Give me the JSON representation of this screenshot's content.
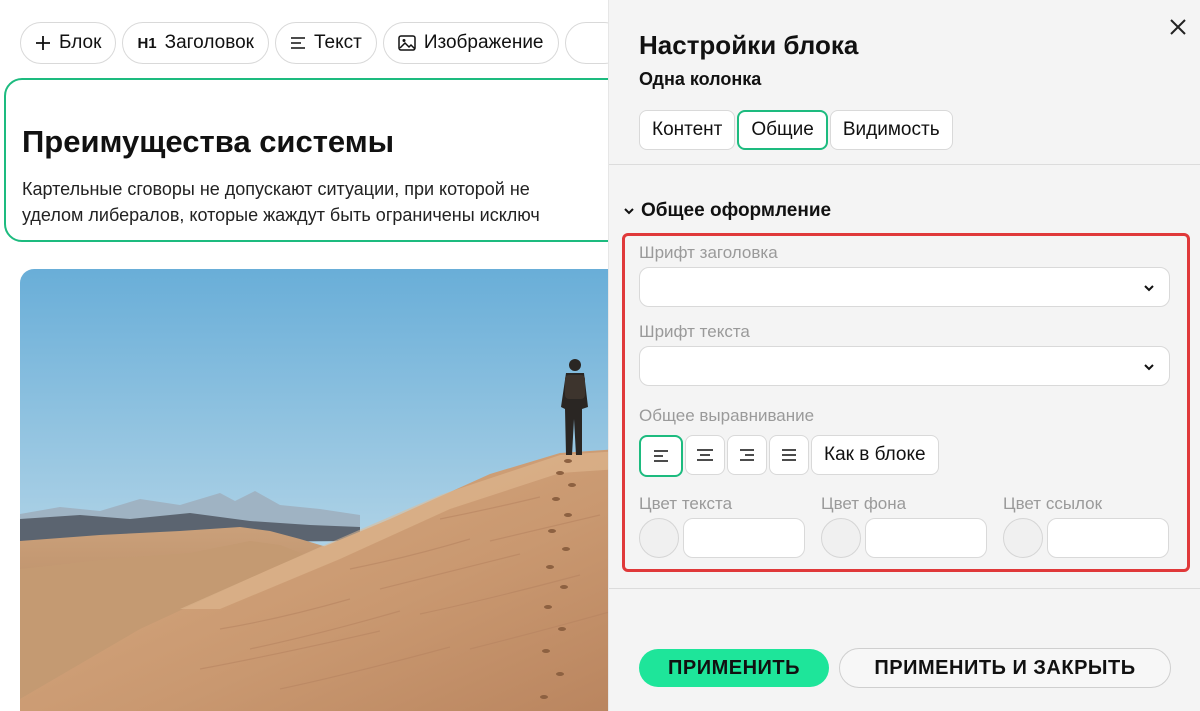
{
  "toolbar": {
    "add_block": "Блок",
    "heading_tag": "H1",
    "heading": "Заголовок",
    "text": "Текст",
    "image": "Изображение"
  },
  "block": {
    "title": "Преимущества системы",
    "text_line_1": "Картельные сговоры не допускают ситуации, при которой не",
    "text_line_2": "уделом либералов, которые жаждут быть ограничены исключ"
  },
  "panel": {
    "title": "Настройки блока",
    "subtitle": "Одна колонка",
    "tabs": [
      "Контент",
      "Общие",
      "Видимость"
    ],
    "active_tab": "Общие",
    "section_title": "Общее оформление",
    "heading_font_label": "Шрифт заголовка",
    "heading_font_value": "",
    "text_font_label": "Шрифт текста",
    "text_font_value": "",
    "alignment_label": "Общее выравнивание",
    "alignment_options": [
      "left",
      "center",
      "right",
      "justify"
    ],
    "alignment_selected": "left",
    "alignment_as_block": "Как в блоке",
    "text_color_label": "Цвет текста",
    "text_color_value": "",
    "bg_color_label": "Цвет фона",
    "bg_color_value": "",
    "link_color_label": "Цвет ссылок",
    "link_color_value": "",
    "apply": "ПРИМЕНИТЬ",
    "apply_close": "ПРИМЕНИТЬ И ЗАКРЫТЬ"
  },
  "colors": {
    "accent": "#1dbb7f",
    "apply_button": "#1ee59a",
    "highlight_box": "#e0393a"
  },
  "icons": [
    "plus-icon",
    "text-lines-icon",
    "image-icon",
    "close-icon",
    "chevron-down-icon",
    "align-left-icon",
    "align-center-icon",
    "align-right-icon",
    "align-justify-icon"
  ]
}
